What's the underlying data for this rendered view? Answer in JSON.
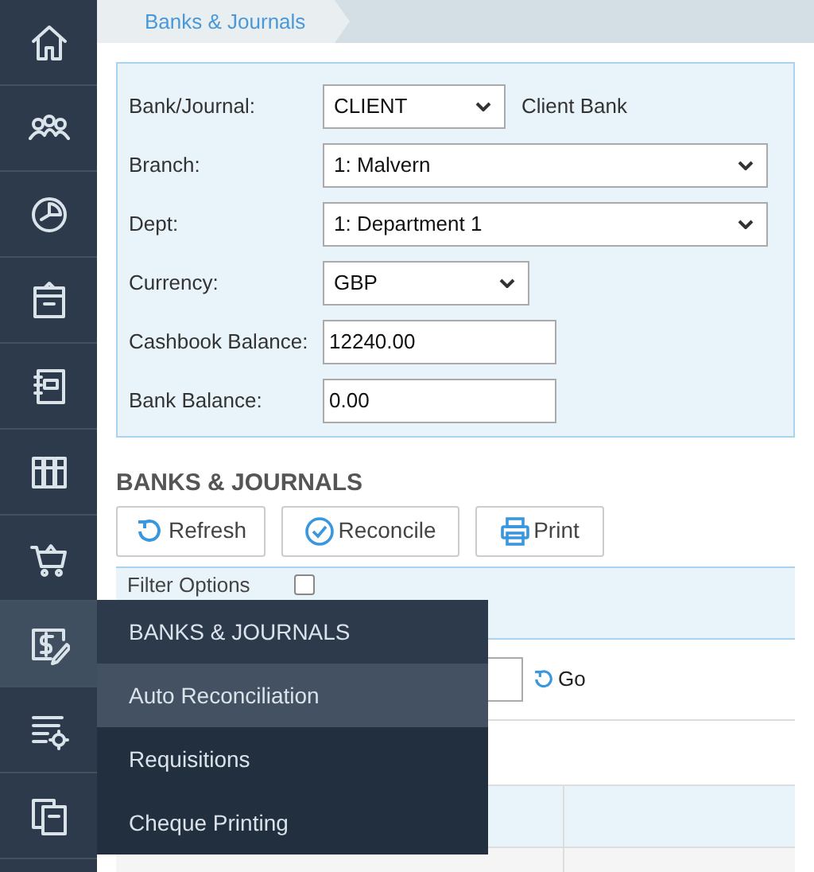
{
  "sidebar": {
    "items": [
      {
        "selected": false
      },
      {
        "selected": false
      },
      {
        "selected": false
      },
      {
        "selected": false
      },
      {
        "selected": false
      },
      {
        "selected": false
      },
      {
        "selected": false
      },
      {
        "selected": true
      },
      {
        "selected": false
      },
      {
        "selected": false
      }
    ]
  },
  "breadcrumb": "Banks & Journals",
  "form": {
    "rows": [
      {
        "kind": "select",
        "label": "Bank/Journal:",
        "value": "CLIENT",
        "note": "Client Bank"
      },
      {
        "kind": "select",
        "label": "Branch:",
        "value": "1: Malvern"
      },
      {
        "kind": "select",
        "label": "Dept:",
        "value": "1: Department 1"
      },
      {
        "kind": "select",
        "label": "Currency:",
        "value": "GBP"
      },
      {
        "kind": "input",
        "label": "Cashbook Balance:",
        "value": "12240.00"
      },
      {
        "kind": "input",
        "label": "Bank Balance:",
        "value": "0.00"
      }
    ]
  },
  "section_title": "BANKS & JOURNALS",
  "toolbar": [
    {
      "label": "Refresh"
    },
    {
      "label": "Reconcile"
    },
    {
      "label": "Print"
    }
  ],
  "filter": {
    "label": "Filter Options",
    "checked": false,
    "go": "Go"
  },
  "menu": {
    "title": "BANKS & JOURNALS",
    "items": [
      {
        "label": "Auto Reconciliation",
        "selected": true
      },
      {
        "label": "Requisitions",
        "selected": false
      },
      {
        "label": "Cheque Printing",
        "selected": false
      }
    ]
  }
}
